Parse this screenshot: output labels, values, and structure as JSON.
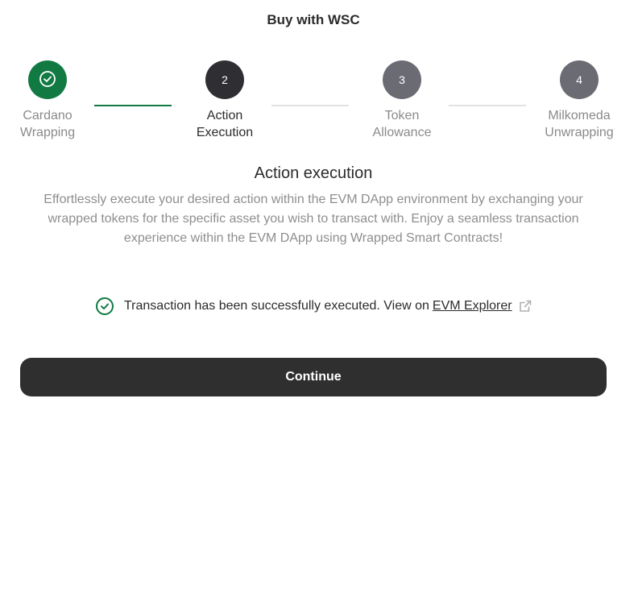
{
  "header": {
    "title": "Buy with WSC"
  },
  "steps": [
    {
      "number": "1",
      "label_line1": "Cardano",
      "label_line2": "Wrapping",
      "state": "done",
      "icon": "check-icon"
    },
    {
      "number": "2",
      "label_line1": "Action",
      "label_line2": "Execution",
      "state": "active"
    },
    {
      "number": "3",
      "label_line1": "Token",
      "label_line2": "Allowance",
      "state": "pending"
    },
    {
      "number": "4",
      "label_line1": "Milkomeda",
      "label_line2": "Unwrapping",
      "state": "pending"
    }
  ],
  "main": {
    "section_title": "Action execution",
    "description": "Effortlessly execute your desired action within the EVM DApp environment by exchanging your wrapped tokens for the specific asset you wish to transact with. Enjoy a seamless transaction experience within the EVM DApp using Wrapped Smart Contracts!",
    "status_text": "Transaction has been successfully executed. View on",
    "explorer_link": "EVM Explorer",
    "status_icon": "check-circle-icon",
    "link_icon": "external-link-icon"
  },
  "actions": {
    "continue_label": "Continue"
  },
  "colors": {
    "success": "#117a43",
    "active": "#2f2f33",
    "pending": "#6b6b73",
    "button": "#2f2f2f"
  }
}
